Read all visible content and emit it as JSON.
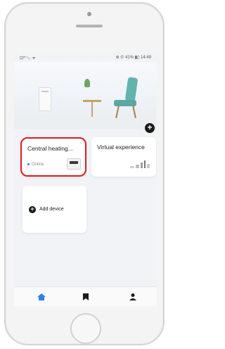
{
  "status_bar": {
    "left": "⊡ᴴ⁺ᵢᵢ ᯤ",
    "right": "⊛ ✆ 41% ▮▯ 14:49"
  },
  "add_button": {
    "symbol": "+"
  },
  "devices": [
    {
      "name": "Central heating...",
      "status": "Online",
      "status_color": "#2f80ed",
      "highlight_color": "#e11b22"
    },
    {
      "name": "Virtual experience"
    }
  ],
  "add_device": {
    "label": "Add device",
    "symbol": "+"
  },
  "tabbar": {
    "tabs": [
      {
        "icon": "home-icon",
        "active": true,
        "color": "#2f80ed"
      },
      {
        "icon": "bookmark-icon",
        "active": false,
        "color": "#1a1a1a"
      },
      {
        "icon": "profile-icon",
        "active": false,
        "color": "#1a1a1a"
      }
    ]
  }
}
